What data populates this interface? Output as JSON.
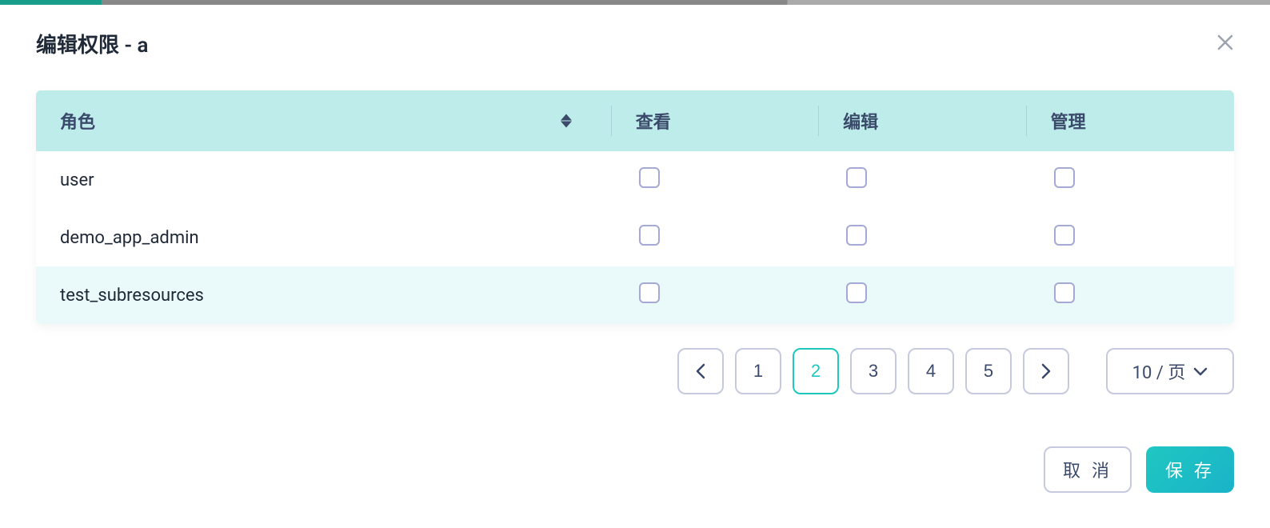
{
  "modal": {
    "title": "编辑权限 - a"
  },
  "table": {
    "headers": {
      "role": "角色",
      "view": "查看",
      "edit": "编辑",
      "manage": "管理"
    },
    "rows": [
      {
        "role": "user",
        "view": false,
        "edit": false,
        "manage": false,
        "highlight": false
      },
      {
        "role": "demo_app_admin",
        "view": false,
        "edit": false,
        "manage": false,
        "highlight": false
      },
      {
        "role": "test_subresources",
        "view": false,
        "edit": false,
        "manage": false,
        "highlight": true
      }
    ]
  },
  "pagination": {
    "pages": [
      "1",
      "2",
      "3",
      "4",
      "5"
    ],
    "active": "2",
    "page_size": "10 / 页"
  },
  "footer": {
    "cancel": "取 消",
    "save": "保 存"
  }
}
